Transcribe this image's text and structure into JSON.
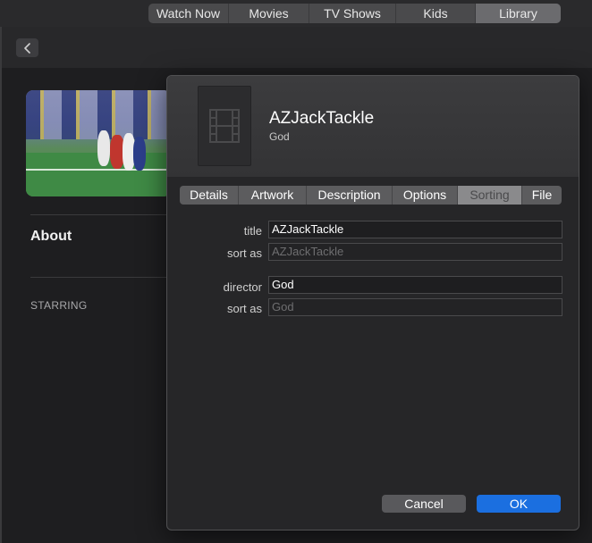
{
  "topnav": {
    "tabs": [
      {
        "label": "Watch Now"
      },
      {
        "label": "Movies"
      },
      {
        "label": "TV Shows"
      },
      {
        "label": "Kids"
      },
      {
        "label": "Library",
        "active": true
      }
    ]
  },
  "background": {
    "about": "About",
    "starring": "STARRING"
  },
  "dialog": {
    "title": "AZJackTackle",
    "subtitle": "God",
    "tabs": [
      {
        "label": "Details"
      },
      {
        "label": "Artwork"
      },
      {
        "label": "Description"
      },
      {
        "label": "Options"
      },
      {
        "label": "Sorting",
        "selected": true
      },
      {
        "label": "File"
      }
    ],
    "fields": {
      "title_label": "title",
      "title_value": "AZJackTackle",
      "title_sort_label": "sort as",
      "title_sort_placeholder": "AZJackTackle",
      "director_label": "director",
      "director_value": "God",
      "director_sort_label": "sort as",
      "director_sort_placeholder": "God"
    },
    "cancel_label": "Cancel",
    "ok_label": "OK"
  },
  "colors": {
    "accent": "#1b6fe0",
    "background": "#1e1e20"
  }
}
